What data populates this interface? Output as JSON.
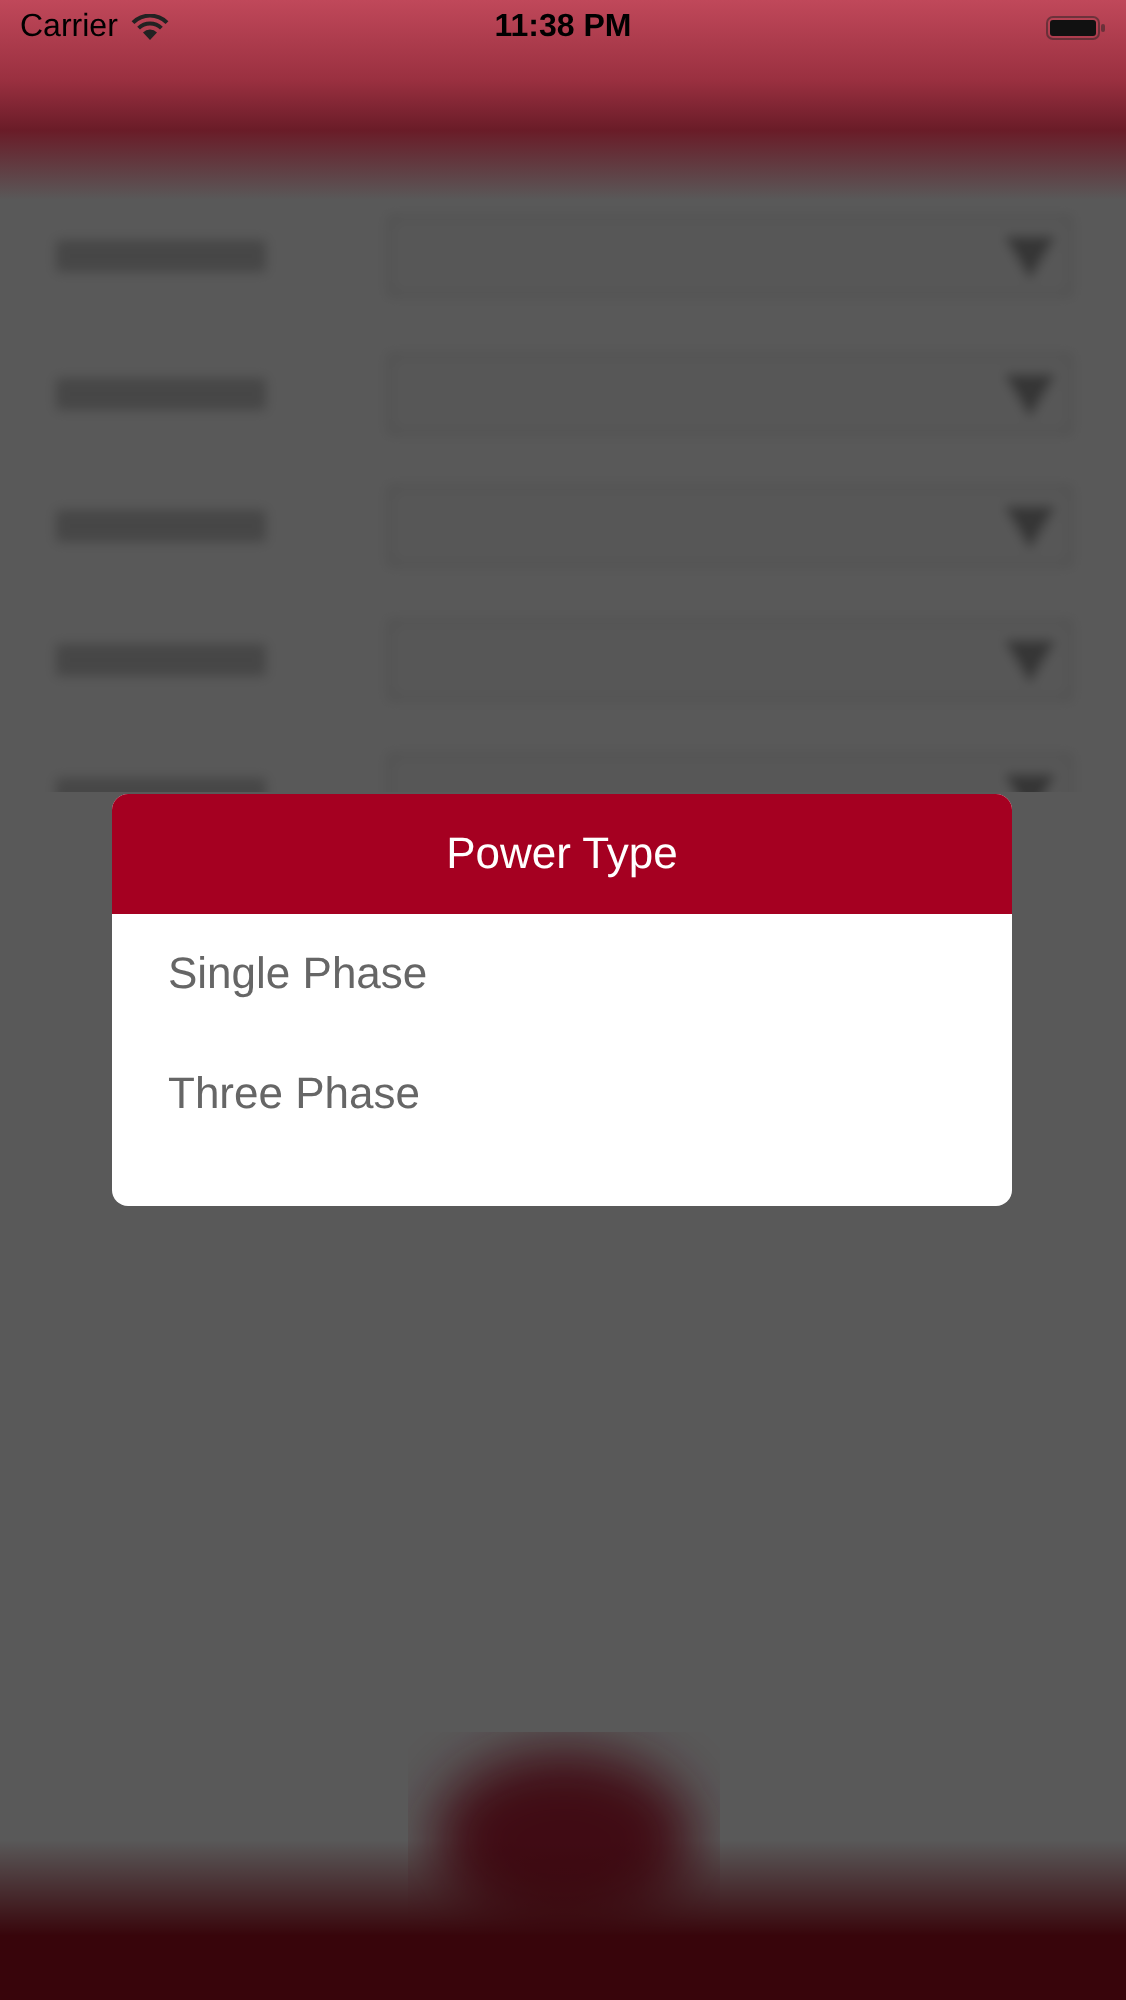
{
  "status_bar": {
    "carrier": "Carrier",
    "time": "11:38 PM"
  },
  "dialog": {
    "title": "Power Type",
    "options": [
      {
        "label": "Single Phase"
      },
      {
        "label": "Three Phase"
      }
    ]
  }
}
